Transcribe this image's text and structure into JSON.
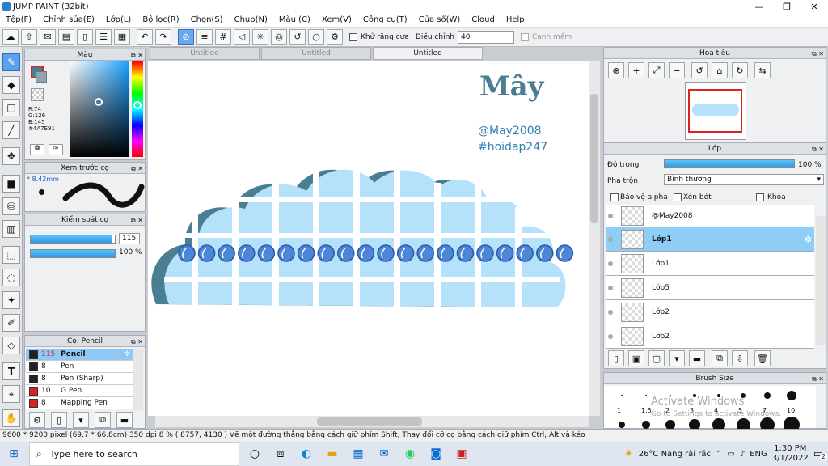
{
  "window": {
    "title": "JUMP PAINT (32bit)",
    "min": "—",
    "max": "❐",
    "close": "✕"
  },
  "menu": [
    "Tệp(F)",
    "Chỉnh sửa(E)",
    "Lớp(L)",
    "Bộ lọc(R)",
    "Chọn(S)",
    "Chụp(N)",
    "Màu (C)",
    "Xem(V)",
    "Công cụ(T)",
    "Cửa sổ(W)",
    "Cloud",
    "Help"
  ],
  "toolbar": {
    "antialias": "Khử răng cưa",
    "adjust": "Điều chỉnh",
    "adjust_value": "40",
    "snap": "Cạnh mềm"
  },
  "color_panel": {
    "title": "Màu",
    "r": "R:74",
    "g": "G:126",
    "b": "B:145",
    "hex": "#4A7E91",
    "swatch": "#4a7e91"
  },
  "brush_preview": {
    "title": "Xem trước cọ",
    "size": "* 8.42mm"
  },
  "brush_control": {
    "title": "Kiểm soát cọ",
    "size": "115",
    "opacity": "100 %",
    "size_level": 0.97,
    "opacity_level": 1.0
  },
  "brush_list": {
    "title": "Cọ: Pencil",
    "items": [
      {
        "size": "115",
        "name": "Pencil",
        "color": "#222222"
      },
      {
        "size": "8",
        "name": "Pen",
        "color": "#222222"
      },
      {
        "size": "8",
        "name": "Pen (Sharp)",
        "color": "#222222"
      },
      {
        "size": "10",
        "name": "G Pen",
        "color": "#e02020"
      },
      {
        "size": "8",
        "name": "Mapping Pen",
        "color": "#e02020"
      }
    ]
  },
  "tabs": [
    "Untitled",
    "Untitled",
    "Untitled"
  ],
  "canvas": {
    "logo": "Mây",
    "handle": "@May2008",
    "tag": "#hoidap247"
  },
  "navigator": {
    "title": "Hoa tiêu"
  },
  "layer_panel": {
    "title": "Lớp",
    "opacity_label": "Độ trong",
    "opacity_value": "100 %",
    "blend_label": "Pha trộn",
    "blend_value": "Bình thường",
    "protect": "Bảo vệ alpha",
    "clip": "Xén bớt",
    "lock": "Khóa",
    "opacity_level": 1.0,
    "layers": [
      "@May2008",
      "Lớp1",
      "Lớp1",
      "Lớp5",
      "Lớp2",
      "Lớp2"
    ]
  },
  "brush_size": {
    "title": "Brush Size",
    "labels": [
      "1",
      "1.5",
      "2",
      "3",
      "4",
      "5",
      "7",
      "10"
    ],
    "watermark1": "Activate Windows",
    "watermark2": "Go to Settings to activate Windows."
  },
  "status": "9600 * 9200 pixel   (69.7 * 66.8cm)   350 dpi   8 %   ( 8757, 4130 )   Vẽ một đường thẳng bằng cách giữ phím Shift, Thay đổi cỡ cọ bằng cách giữ phím Ctrl, Alt và kéo",
  "taskbar": {
    "search": "Type here to search",
    "weather": "26°C  Nắng rải rác",
    "lang": "ENG",
    "time": "1:30 PM",
    "date": "3/1/2022",
    "badge": "2"
  }
}
